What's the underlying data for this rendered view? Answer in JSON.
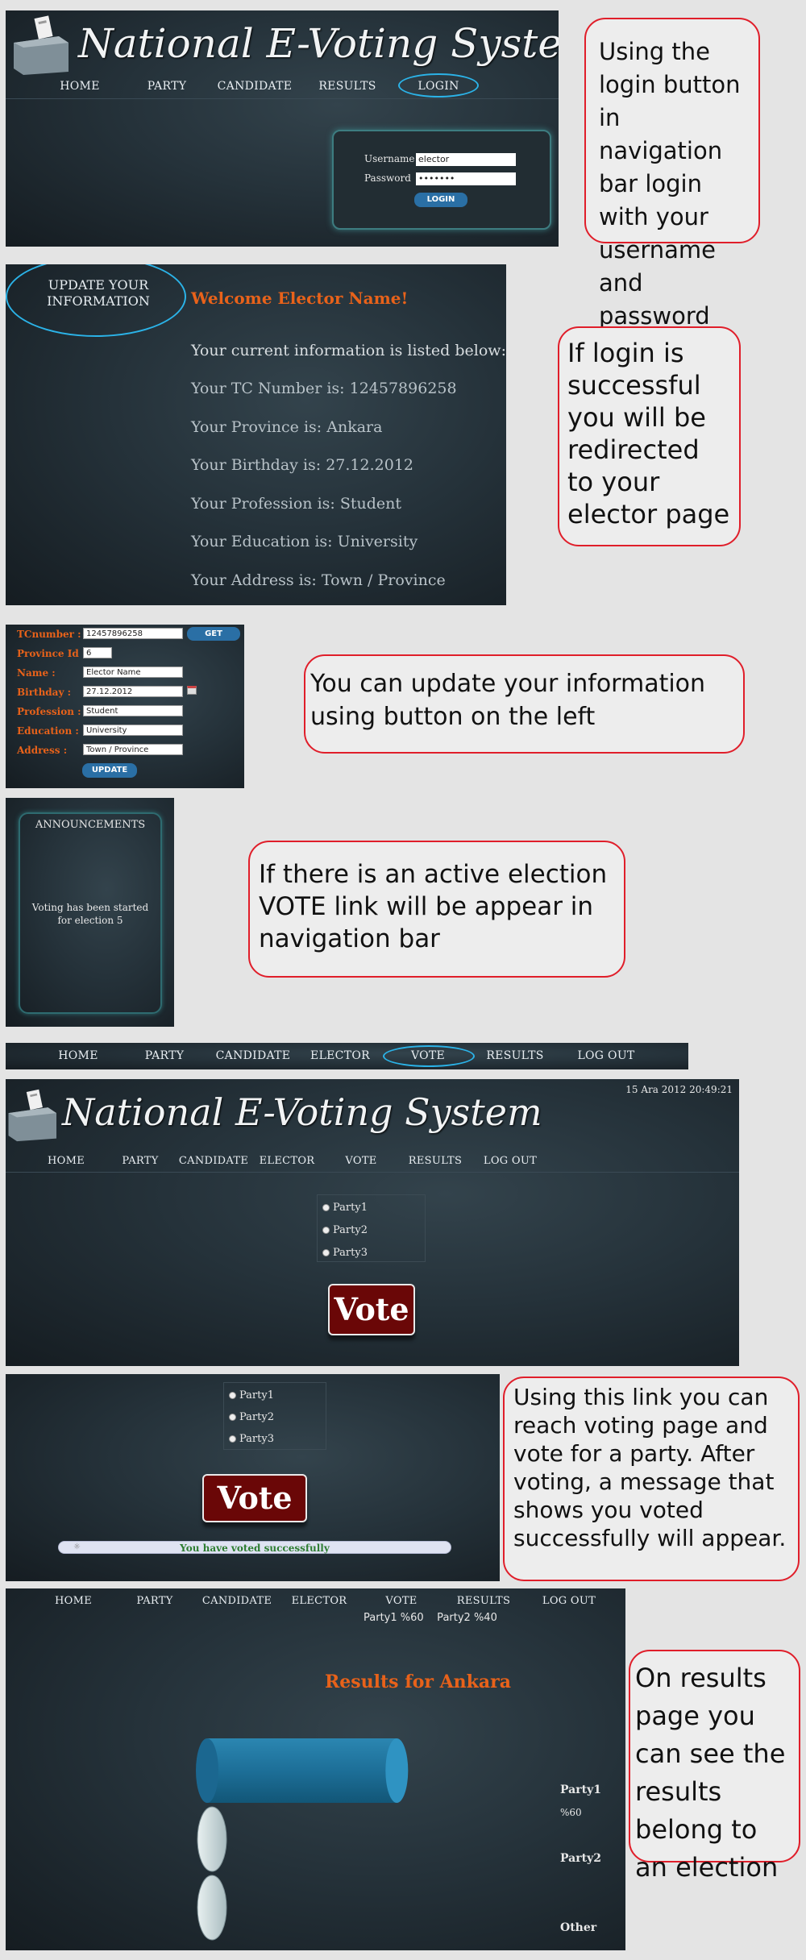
{
  "app": {
    "title": "National E-Voting System"
  },
  "nav_login": {
    "items": [
      "HOME",
      "PARTY",
      "CANDIDATE",
      "RESULTS",
      "LOGIN"
    ]
  },
  "login": {
    "username_label": "Username",
    "username_value": "elector",
    "password_label": "Password",
    "password_value": "•••••••",
    "button": "LOGIN"
  },
  "elector": {
    "update_link": "UPDATE YOUR INFORMATION",
    "welcome": "Welcome Elector Name!",
    "lines": [
      "Your current information is listed below:",
      "Your TC Number is: 12457896258",
      "Your Province is: Ankara",
      "Your Birthday is: 27.12.2012",
      "Your Profession is: Student",
      "Your Education is: University",
      "Your Address is: Town / Province"
    ]
  },
  "form": {
    "tc_label": "TCnumber :",
    "tc_value": "12457896258",
    "get_button": "GET",
    "province_label": "Province Id :",
    "province_value": "6",
    "name_label": "Name :",
    "name_value": "Elector Name",
    "birthday_label": "Birthday :",
    "birthday_value": "27.12.2012",
    "profession_label": "Profession :",
    "profession_value": "Student",
    "education_label": "Education :",
    "education_value": "University",
    "address_label": "Address :",
    "address_value": "Town / Province",
    "update_button": "UPDATE"
  },
  "announcements": {
    "title": "ANNOUNCEMENTS",
    "text": "Voting has been started for election 5"
  },
  "nav_logged": {
    "items": [
      "HOME",
      "PARTY",
      "CANDIDATE",
      "ELECTOR",
      "VOTE",
      "RESULTS",
      "LOG OUT"
    ]
  },
  "vote_page": {
    "timestamp": "15 Ara 2012 20:49:21",
    "options": [
      "Party1",
      "Party2",
      "Party3"
    ],
    "vote_button": "Vote",
    "success": "You have voted successfully"
  },
  "results": {
    "summary": "Party1 %60    Party2 %40",
    "title": "Results for Ankara",
    "labels": [
      "Party1",
      "%60",
      "Party2",
      "Other"
    ],
    "values": [
      60,
      40,
      0
    ]
  },
  "callouts": {
    "c1": "Using the login button in navigation bar login with your username and password",
    "c2": "If login is successful you will be redirected to your elector page",
    "c3": "You can update your information using button on the left",
    "c4": "If there is an active election VOTE link will be appear in navigation bar",
    "c5": "Using this link you can reach voting page and vote for a party. After voting, a message that shows you voted successfully will appear.",
    "c6": "On results page you can see the results belong to an election"
  },
  "colors": {
    "accent": "#e8621a",
    "highlight": "#2bb3e8",
    "callout_border": "#e01e2a",
    "vote": "#6a0707"
  },
  "icons": {
    "ballot": "ballot-box-icon",
    "calendar": "calendar-icon"
  }
}
